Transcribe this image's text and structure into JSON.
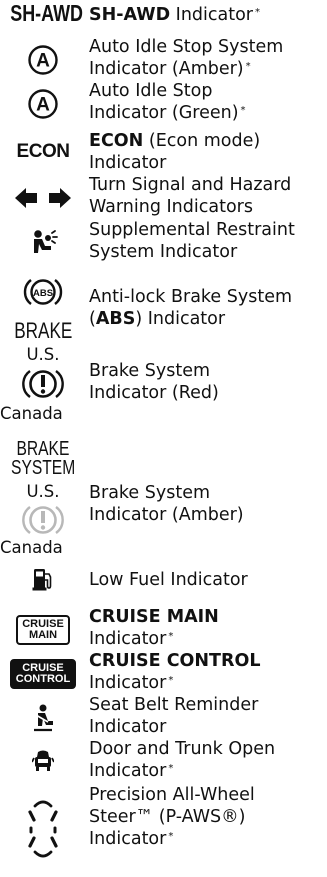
{
  "rows": [
    {
      "icon": "SH-AWD",
      "bold": "SH-AWD",
      "text": " Indicator",
      "star": "*"
    },
    {
      "icon": "auto-idle-amber-icon",
      "line1": "Auto Idle Stop System",
      "line2": "Indicator (Amber)",
      "star": "*"
    },
    {
      "icon": "auto-idle-green-icon",
      "line1": "Auto Idle Stop",
      "line2": "Indicator (Green)",
      "star": "*"
    },
    {
      "icon": "ECON",
      "bold": "ECON",
      "text": " (Econ mode)",
      "line2": "Indicator"
    },
    {
      "icon": "turn-signal-icon",
      "line1": "Turn Signal and Hazard",
      "line2": "Warning Indicators"
    },
    {
      "icon": "srs-icon",
      "line1": "Supplemental Restraint",
      "line2": "System Indicator"
    },
    {
      "icon_labels": [
        "BRAKE"
      ],
      "pre": "Anti-lock Brake System",
      "open": "(",
      "bold": "ABS",
      "post": ") Indicator"
    },
    {
      "region_top": "U.S.",
      "region_bottom": "Canada",
      "line1": "Brake System",
      "line2": "Indicator (Red)"
    },
    {
      "icon_labels": [
        "BRAKE",
        "SYSTEM"
      ],
      "region_top": "U.S.",
      "region_bottom": "Canada",
      "line1": "Brake System",
      "line2": "Indicator (Amber)"
    },
    {
      "icon": "fuel-pump-icon",
      "line1": "Low Fuel Indicator"
    },
    {
      "icon_labels": [
        "CRUISE",
        "MAIN"
      ],
      "bold": "CRUISE MAIN",
      "line2": "Indicator",
      "star": "*"
    },
    {
      "icon_labels": [
        "CRUISE",
        "CONTROL"
      ],
      "bold": "CRUISE CONTROL",
      "line2": "Indicator",
      "star": "*"
    },
    {
      "icon": "seat-belt-icon",
      "line1": "Seat Belt Reminder",
      "line2": "Indicator"
    },
    {
      "icon": "door-open-icon",
      "line1": "Door and Trunk Open",
      "line2": "Indicator",
      "star": "*"
    },
    {
      "icon": "p-aws-icon",
      "line1": "Precision All-Wheel",
      "line2": "Steer™ (P-AWS®)",
      "line3": "Indicator",
      "star": "*"
    }
  ],
  "colors": {
    "text": "#111111",
    "amber_brake_icon": "#b8b8b8"
  }
}
